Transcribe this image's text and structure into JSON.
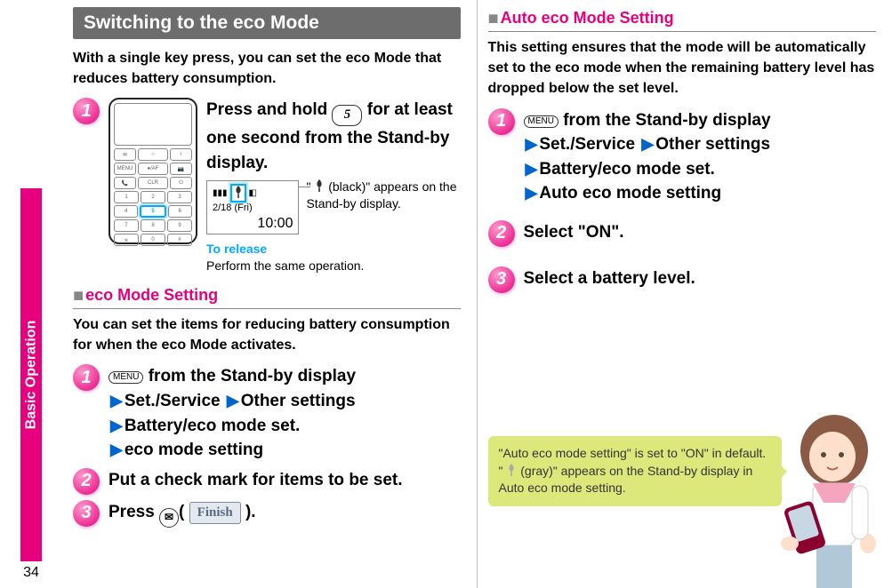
{
  "spine": {
    "label": "Basic Operation",
    "page": "34"
  },
  "left": {
    "title": "Switching to the eco Mode",
    "intro": "With a single key press, you can set the eco Mode that reduces battery consumption.",
    "step1_line1": "Press and hold ",
    "step1_key": "5",
    "step1_line2": " for at least one second from the Stand-by display.",
    "status_date": "2/18 (Fri)",
    "status_time": "10:00",
    "annot_prefix": "\" ",
    "annot_suffix": " (black)\" appears on the Stand-by display.",
    "release_label": "To release",
    "release_text": "Perform the same operation.",
    "sub1": {
      "title": "eco Mode Setting"
    },
    "sub1_desc": "You can set the items for reducing battery consumption for when the eco Mode activates.",
    "s1_step1_menu": "MENU",
    "s1_step1_from": " from the Stand-by display",
    "s1_step1_path1": "Set./Service",
    "s1_step1_path2": "Other settings",
    "s1_step1_path3": "Battery/eco mode set.",
    "s1_step1_path4": "eco mode setting",
    "s1_step2": "Put a check mark for items to be set.",
    "s1_step3_prefix": "Press ",
    "s1_step3_finish": "Finish",
    "s1_step3_suffix": ")."
  },
  "right": {
    "sub2": {
      "title": "Auto eco Mode Setting"
    },
    "sub2_desc": "This setting ensures that the mode will be automatically set to the eco mode when the remaining battery level has dropped below the set level.",
    "r_step1_menu": "MENU",
    "r_step1_from": " from the Stand-by display",
    "r_step1_path1": "Set./Service",
    "r_step1_path2": "Other settings",
    "r_step1_path3": "Battery/eco mode set.",
    "r_step1_path4": "Auto eco mode setting",
    "r_step2": "Select \"ON\".",
    "r_step3": "Select a battery level.",
    "tip_prefix": "\"Auto eco mode setting\" is set to \"ON\" in default. \" ",
    "tip_suffix": " (gray)\" appears on the Stand-by display in Auto eco mode setting."
  },
  "stepnums": {
    "n1": "1",
    "n2": "2",
    "n3": "3"
  }
}
